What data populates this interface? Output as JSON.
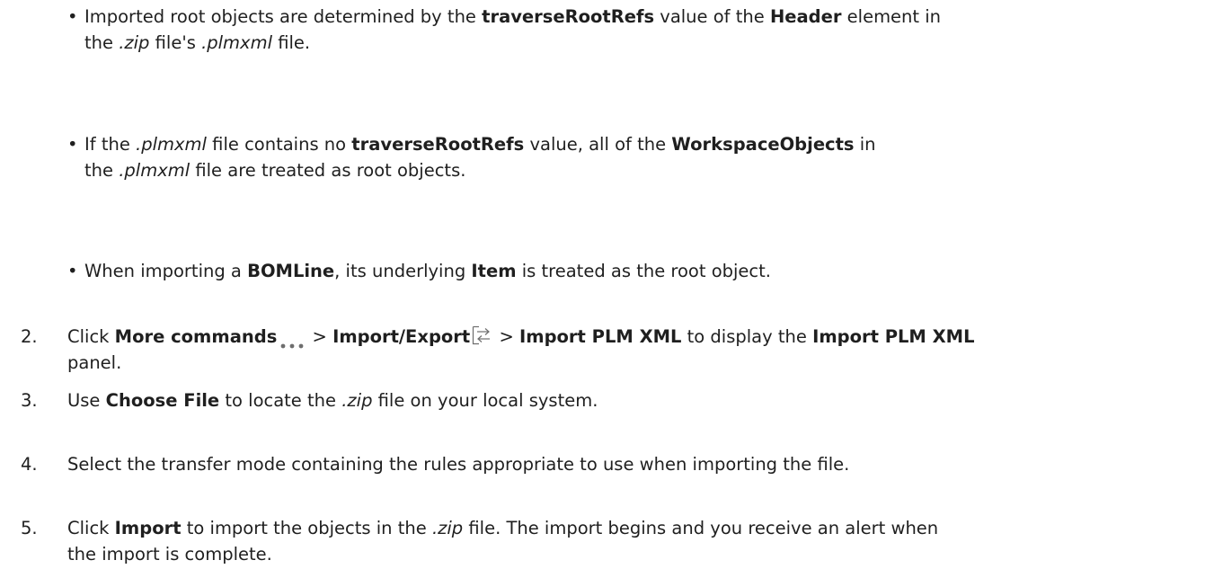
{
  "bullets": [
    {
      "b1_t1": "Imported root objects are determined by the ",
      "b1_b1": "traverseRootRefs",
      "b1_t2": " value of the ",
      "b1_b2": "Header",
      "b1_t3": " element in",
      "b1_t4": "the ",
      "b1_i1": ".zip",
      "b1_t5": " file's ",
      "b1_i2": ".plmxml",
      "b1_t6": " file."
    },
    {
      "t1": "If the ",
      "i1": ".plmxml",
      "t2": " file contains no ",
      "b1": "traverseRootRefs",
      "t3": " value, all of the ",
      "b2": "WorkspaceObjects",
      "t4": " in",
      "t5": "the ",
      "i2": ".plmxml",
      "t6": " file are treated as root objects."
    },
    {
      "t1": "When importing a ",
      "b1": "BOMLine",
      "t2": ", its underlying ",
      "b2": "Item",
      "t3": " is treated as the root object."
    }
  ],
  "bullet_marker": "•",
  "steps": [
    {
      "num": "2.",
      "t1": "Click ",
      "b1": "More commands",
      "icon1": "more-commands-icon",
      "t2": " > ",
      "b2": "Import/Export",
      "icon2": "import-export-icon",
      "t3": " > ",
      "b3": "Import PLM XML",
      "t4": " to display the ",
      "b4": "Import PLM XML",
      "t5": "panel."
    },
    {
      "num": "3.",
      "t1": "Use ",
      "b1": "Choose File",
      "t2": " to locate the ",
      "i1": ".zip",
      "t3": " file on your local system."
    },
    {
      "num": "4.",
      "t1": "Select the transfer mode containing the rules appropriate to use when importing the file."
    },
    {
      "num": "5.",
      "t1": "Click ",
      "b1": "Import",
      "t2": " to import the objects in the ",
      "i1": ".zip",
      "t3": " file. The import begins and you receive an alert when",
      "t4": "the import is complete."
    }
  ],
  "colors": {
    "text": "#1f1f1f",
    "icon": "#6e6e6e",
    "background": "#ffffff"
  }
}
